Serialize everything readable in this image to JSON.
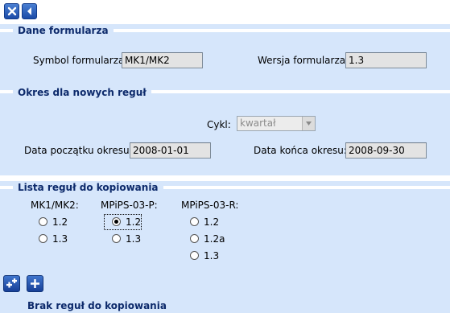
{
  "toolbar": {
    "close_icon": "close-icon",
    "back_icon": "back-icon"
  },
  "form_data": {
    "title": "Dane formularza",
    "symbol_label": "Symbol formularza:",
    "symbol_value": "MK1/MK2",
    "version_label": "Wersja formularza:",
    "version_value": "1.3"
  },
  "period": {
    "title": "Okres dla nowych reguł",
    "cycle_label": "Cykl:",
    "cycle_value": "kwartał",
    "start_label": "Data początku okresu:",
    "start_value": "2008-01-01",
    "end_label": "Data końca okresu:",
    "end_value": "2008-09-30"
  },
  "rules": {
    "title": "Lista reguł do kopiowania",
    "columns": [
      {
        "header": "MK1/MK2:",
        "options": [
          "1.2",
          "1.3"
        ],
        "selected": null
      },
      {
        "header": "MPiPS-03-P:",
        "options": [
          "1.2",
          "1.3"
        ],
        "selected": "1.2"
      },
      {
        "header": "MPiPS-03-R:",
        "options": [
          "1.2",
          "1.2a",
          "1.3"
        ],
        "selected": null
      }
    ]
  },
  "footer": {
    "empty_text": "Brak reguł do kopiowania"
  },
  "colors": {
    "panel": "#d6e6fb",
    "title": "#0d2a6b",
    "button": "#1b4ba7"
  }
}
